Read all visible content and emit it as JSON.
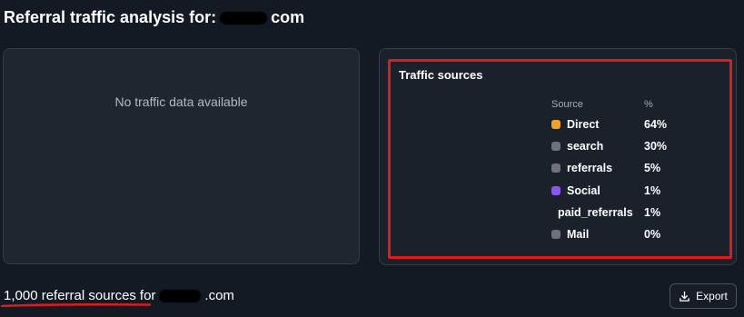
{
  "header": {
    "title_prefix": "Referral traffic analysis for:",
    "title_suffix": "com"
  },
  "empty_panel": {
    "message": "No traffic data available"
  },
  "traffic_sources": {
    "title": "Traffic sources",
    "column_source": "Source",
    "column_percent": "%",
    "rows": [
      {
        "name": "Direct",
        "percent": "64%",
        "value": 64,
        "color": "#f0a12a",
        "has_dot": true
      },
      {
        "name": "search",
        "percent": "30%",
        "value": 30,
        "color": "#6e737b",
        "has_dot": true
      },
      {
        "name": "referrals",
        "percent": "5%",
        "value": 5,
        "color": "#6e737b",
        "has_dot": true
      },
      {
        "name": "Social",
        "percent": "1%",
        "value": 1,
        "color": "#8957f0",
        "has_dot": true
      },
      {
        "name": "paid_referrals",
        "percent": "1%",
        "value": 1,
        "color": "",
        "has_dot": false
      },
      {
        "name": "Mail",
        "percent": "0%",
        "value": 0,
        "color": "#6e737b",
        "has_dot": true
      }
    ]
  },
  "referral_sources": {
    "count_label": "1,000 referral sources",
    "for_label": "for",
    "domain_suffix": ".com"
  },
  "toolbar": {
    "export_label": "Export",
    "export_icon": "download-icon"
  },
  "colors": {
    "background": "#131a24",
    "card": "#1f262f",
    "highlight": "#e01b1b",
    "direct": "#f0a12a",
    "social": "#8957f0",
    "gray": "#6e737b"
  }
}
